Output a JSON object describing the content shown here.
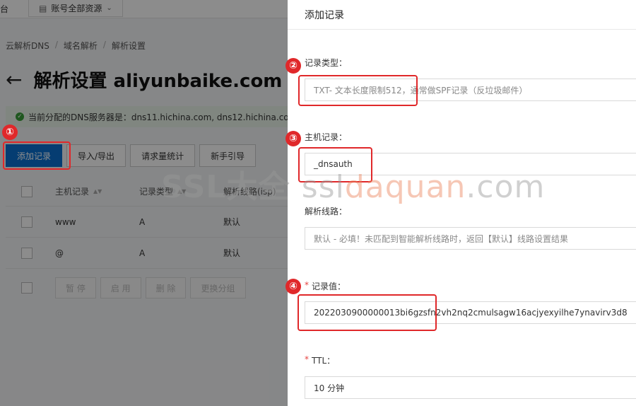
{
  "topbar": {
    "left_fragment": "台",
    "resources_label": "账号全部资源",
    "resources_icon": "grid-icon",
    "dropdown_icon": "chevron-down-icon"
  },
  "breadcrumb": {
    "items": [
      "云解析DNS",
      "域名解析",
      "解析设置"
    ],
    "separator": "/"
  },
  "page": {
    "back_icon": "arrow-left-icon",
    "title": "解析设置 aliyunbaike.com"
  },
  "notice": {
    "text": "当前分配的DNS服务器是：dns11.hichina.com, dns12.hichina.co"
  },
  "toolbar": {
    "add": "添加记录",
    "import_export": "导入/导出",
    "stats": "请求量统计",
    "guide": "新手引导"
  },
  "table": {
    "headers": [
      "主机记录",
      "记录类型",
      "解析线路(isp)"
    ],
    "rows": [
      {
        "host": "www",
        "type": "A",
        "line": "默认"
      },
      {
        "host": "@",
        "type": "A",
        "line": "默认"
      }
    ]
  },
  "bulk": {
    "pause": "暂 停",
    "enable": "启 用",
    "delete": "删 除",
    "change_group": "更换分组"
  },
  "drawer": {
    "title": "添加记录",
    "record_type": {
      "label": "记录类型：",
      "value": "TXT- 文本长度限制512，通常做SPF记录（反垃圾邮件）"
    },
    "host": {
      "label": "主机记录：",
      "value": "_dnsauth"
    },
    "line": {
      "label": "解析线路：",
      "value": "默认 - 必填！未匹配到智能解析线路时，返回【默认】线路设置结果"
    },
    "record_value": {
      "required": "*",
      "label": "记录值：",
      "value": "2022030900000013bi6gzsfn2vh2nq2cmulsagw16acjyexyilhe7ynavirv3d8"
    },
    "ttl": {
      "required": "*",
      "label": "TTL：",
      "value": "10 分钟"
    }
  },
  "annotations": {
    "n1": "①",
    "n2": "②",
    "n3": "③",
    "n4": "④",
    "color": "#e0282a"
  },
  "watermark": {
    "part1": "SSL大全",
    "part2": "ssl",
    "part3": "daquan",
    "part4": ".com"
  }
}
